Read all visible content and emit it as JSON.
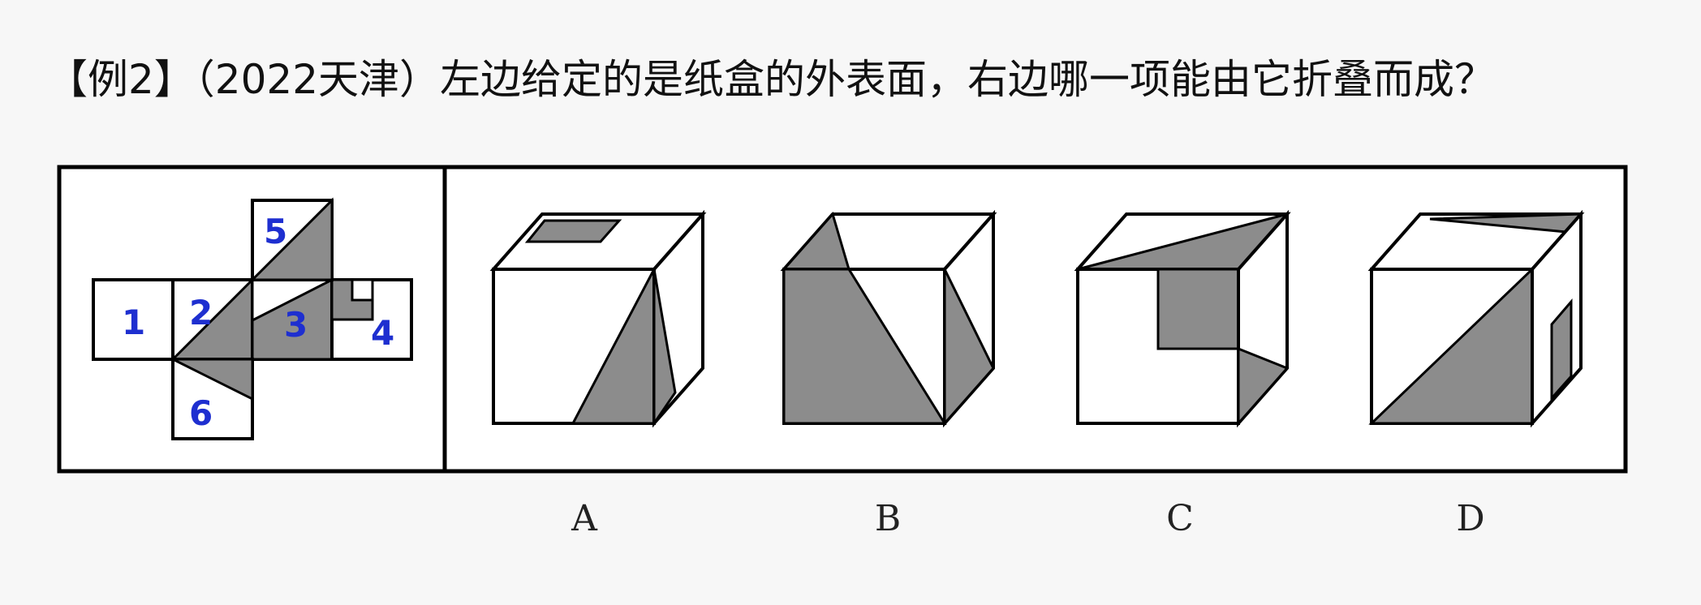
{
  "question": {
    "text": "【例2】（2022天津）左边给定的是纸盒的外表面，右边哪一项能由它折叠而成？"
  },
  "net": {
    "faces": [
      "1",
      "2",
      "3",
      "4",
      "5",
      "6"
    ]
  },
  "options": [
    {
      "label": "A"
    },
    {
      "label": "B"
    },
    {
      "label": "C"
    },
    {
      "label": "D"
    }
  ],
  "colors": {
    "shade": "#8c8c8c",
    "line": "#000000",
    "number": "#1e2fd0"
  }
}
